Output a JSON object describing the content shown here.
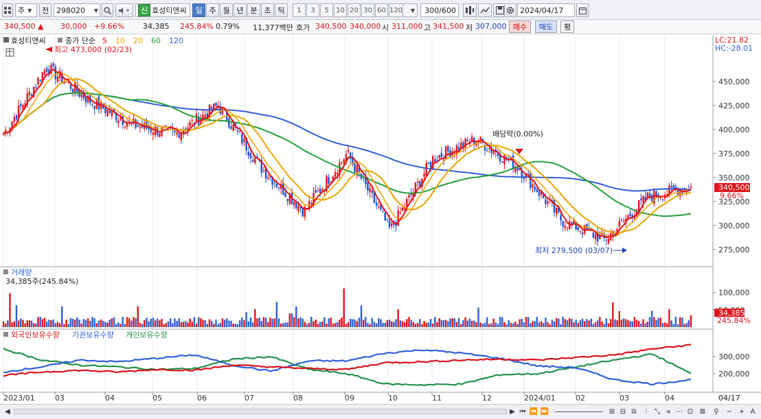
{
  "toolbar": {
    "market": "주",
    "market_caret": "▼",
    "prefix": "전",
    "code": "298020",
    "name_badge": "신",
    "name": "효성티앤씨",
    "periods": [
      "일",
      "주",
      "월",
      "년",
      "분",
      "초",
      "틱"
    ],
    "active_period": "일",
    "nums": [
      "1",
      "3",
      "5",
      "10",
      "20",
      "30",
      "60",
      "120"
    ],
    "count": "300",
    "count_total": "/600",
    "date": "2024/04/17"
  },
  "quote": {
    "price": "340,500",
    "change_arrow": "▲",
    "change": "30,000",
    "change_pct": "+9.66%",
    "volume": "34,385",
    "volume_ratio": "245.84%",
    "turnover_pct": "0.79%",
    "amount": "11,377백만",
    "ask_label": "호가",
    "ask1": "340,500",
    "ask2": "340,000",
    "open_label": "시",
    "open": "311,000",
    "high_label": "고",
    "high": "341,500",
    "low_label": "저",
    "low": "307,000",
    "buy_label": "매수",
    "sell_label": "매도",
    "eval_label": "평"
  },
  "price_panel": {
    "stock_label": "효성티앤씨",
    "legend_label": "종가 단순",
    "ma_periods": [
      {
        "label": "5",
        "color": "#e0141c"
      },
      {
        "label": "10",
        "color": "#f2a100"
      },
      {
        "label": "20",
        "color": "#e8a400"
      },
      {
        "label": "60",
        "color": "#23a03a"
      },
      {
        "label": "120",
        "color": "#2f5fd8"
      }
    ],
    "high_marker": "최고 473,000 (02/23)",
    "low_marker": "최저 279,500 (03/07)",
    "dividend_marker": "배당락(0.00%)",
    "lc_label": "LC:21.82",
    "hc_label": "HC:-28.01",
    "current_price_tag": "340,500",
    "current_pct_tag": "9.66%",
    "y_ticks": [
      "450,000",
      "425,000",
      "400,000",
      "375,000",
      "350,000",
      "325,000",
      "300,000",
      "275,000"
    ]
  },
  "volume_panel": {
    "title": "거래량",
    "summary": "34,385주(245.84%)",
    "y_ticks": [
      "100,000",
      "50,000"
    ],
    "current_tag": "34,385",
    "current_pct_tag": "245.84%"
  },
  "holdings_panel": {
    "legend": [
      {
        "label": "외국인보유수량",
        "color": "#d8141c"
      },
      {
        "label": "기관보유수량",
        "color": "#2f5fd8"
      },
      {
        "label": "개인보유수량",
        "color": "#23914a"
      }
    ],
    "y_ticks": [
      "300,000",
      "200,000"
    ]
  },
  "x_axis": {
    "labels": [
      "2023/01",
      "03",
      "04",
      "05",
      "06",
      "07",
      "08",
      "09",
      "10",
      "11",
      "12",
      "2024/01",
      "02",
      "03",
      "04"
    ],
    "end_label": "04/17"
  },
  "chart_data": {
    "type": "candlestick",
    "price_range": [
      262000,
      482000
    ],
    "close_key_points": [
      {
        "date": "2023/01",
        "close": 395000
      },
      {
        "date": "02/23",
        "close": 465000
      },
      {
        "date": "04",
        "close": 430000
      },
      {
        "date": "05",
        "close": 405000
      },
      {
        "date": "06",
        "close": 395000
      },
      {
        "date": "06",
        "close": 425000
      },
      {
        "date": "07",
        "close": 360000
      },
      {
        "date": "08",
        "close": 315000
      },
      {
        "date": "09",
        "close": 375000
      },
      {
        "date": "10",
        "close": 295000
      },
      {
        "date": "11",
        "close": 370000
      },
      {
        "date": "12",
        "close": 390000
      },
      {
        "date": "2024/01",
        "close": 360000
      },
      {
        "date": "02",
        "close": 305000
      },
      {
        "date": "03/07",
        "close": 285000
      },
      {
        "date": "04",
        "close": 330000
      },
      {
        "date": "04/17",
        "close": 340500
      }
    ],
    "holdings_range": [
      100000,
      380000
    ],
    "foreign_holdings": [
      190000,
      210000,
      220000,
      210000,
      225000,
      220000,
      250000,
      240000,
      230000,
      225000,
      265000,
      270000,
      280000,
      285000,
      280000,
      295000,
      310000,
      345000,
      368000
    ],
    "institution_holdings": [
      210000,
      240000,
      280000,
      270000,
      290000,
      310000,
      250000,
      215000,
      275000,
      275000,
      320000,
      340000,
      320000,
      290000,
      245000,
      235000,
      165000,
      140000,
      165000
    ],
    "individual_holdings": [
      345000,
      280000,
      250000,
      240000,
      225000,
      230000,
      285000,
      300000,
      225000,
      200000,
      140000,
      135000,
      140000,
      195000,
      200000,
      240000,
      280000,
      315000,
      200000
    ]
  }
}
